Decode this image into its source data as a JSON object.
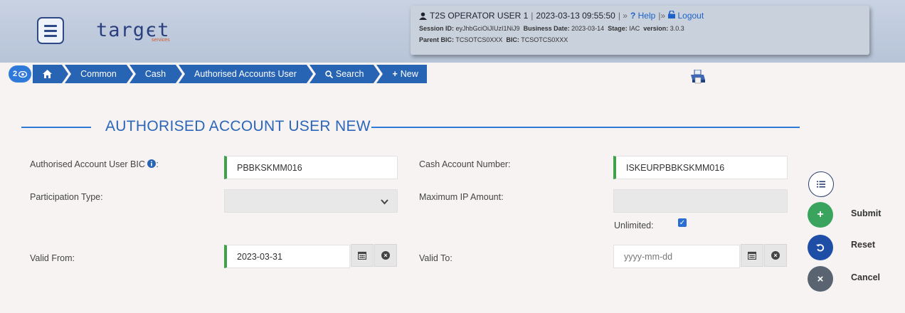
{
  "header": {
    "logo_text": "targєt",
    "logo_sub": "services",
    "user_name": "T2S OPERATOR USER 1",
    "datetime": "2023-03-13 09:55:50",
    "sep1": "| ",
    "sep2": "| » ",
    "sep3": " |» ",
    "help": "Help",
    "logout": "Logout",
    "session_label": "Session ID:",
    "session_id": "eyJhbGciOiJIUzI1NiJ9",
    "business_date_label": "Business Date:",
    "business_date": "2023-03-14",
    "stage_label": "Stage:",
    "stage": "IAC",
    "version_label": "version:",
    "version": "3.0.3",
    "parent_bic_label": "Parent BIC:",
    "parent_bic": "TCSOTCS0XXX",
    "bic_label": "BIC:",
    "bic": "TCSOTCS0XXX"
  },
  "breadcrumb": {
    "badge_count": "2",
    "items": [
      "Common",
      "Cash",
      "Authorised Accounts User",
      "Search",
      "New"
    ]
  },
  "form": {
    "title": "AUTHORISED ACCOUNT USER NEW",
    "bic_label": "Authorised Account User BIC",
    "bic_label_suffix": ":",
    "bic_value": "PBBKSKMM016",
    "cash_account_label": "Cash Account Number:",
    "cash_account_value": "ISKEURPBBKSKMM016",
    "participation_label": "Participation Type:",
    "participation_value": "",
    "max_ip_label": "Maximum IP Amount:",
    "max_ip_value": "",
    "unlimited_label": "Unlimited:",
    "unlimited_checked": true,
    "valid_from_label": "Valid From:",
    "valid_from_value": "2023-03-31",
    "valid_to_label": "Valid To:",
    "valid_to_placeholder": "yyyy-mm-dd"
  },
  "actions": {
    "submit": "Submit",
    "reset": "Reset",
    "cancel": "Cancel"
  },
  "colors": {
    "primary": "#2864b4",
    "submit": "#3aa45e",
    "reset": "#1f4ea6",
    "cancel": "#5a6470",
    "required": "#3fa24a"
  }
}
